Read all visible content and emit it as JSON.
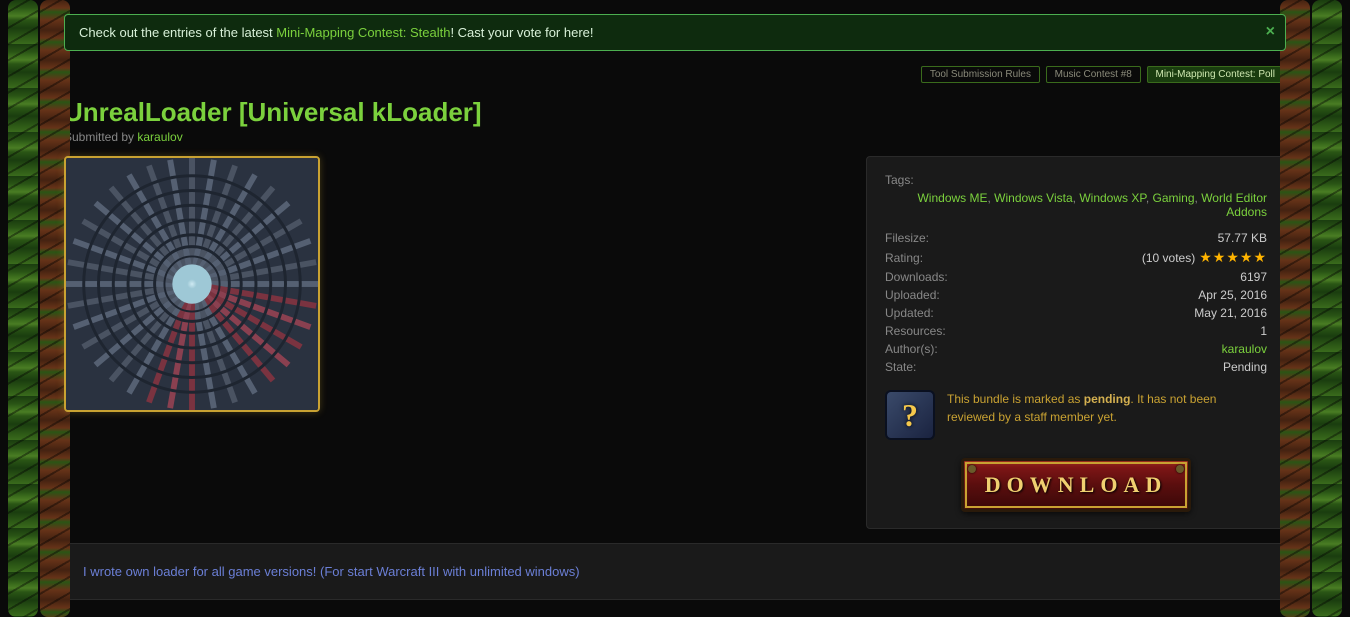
{
  "notice": {
    "pre": "Check out the entries of the latest ",
    "link": "Mini-Mapping Contest: Stealth",
    "post": "! Cast your vote for here!"
  },
  "tabs": [
    {
      "label": "Tool Submission Rules",
      "active": false
    },
    {
      "label": "Music Contest #8",
      "active": false
    },
    {
      "label": "Mini-Mapping Contest: Poll",
      "active": true
    }
  ],
  "title": "UnrealLoader [Universal kLoader]",
  "submitted_by_label": "Submitted by ",
  "submitted_by": "karaulov",
  "tags_label": "Tags:",
  "tags": [
    "Windows ME",
    "Windows Vista",
    "Windows XP",
    "Gaming",
    "World Editor Addons"
  ],
  "info": {
    "filesize_label": "Filesize:",
    "filesize": "57.77 KB",
    "rating_label": "Rating:",
    "votes": "(10 votes)",
    "stars": "★★★★★",
    "downloads_label": "Downloads:",
    "downloads": "6197",
    "uploaded_label": "Uploaded:",
    "uploaded": "Apr 25, 2016",
    "updated_label": "Updated:",
    "updated": "May 21, 2016",
    "resources_label": "Resources:",
    "resources": "1",
    "authors_label": "Author(s):",
    "authors": "karaulov",
    "state_label": "State:",
    "state": "Pending"
  },
  "pending": {
    "pre": "This bundle is marked as ",
    "strong": "pending",
    "post": ". It has not been reviewed by a staff member yet."
  },
  "download_label": "DOWNLOAD",
  "description": "I wrote own loader for all game versions! (For start Warcraft III with unlimited windows)"
}
